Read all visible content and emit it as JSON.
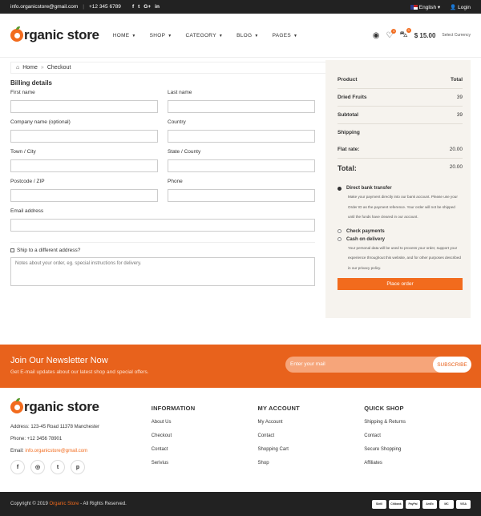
{
  "topbar": {
    "email": "info.organicstore@gmail.com",
    "phone": "+12 345 6789",
    "language": "English",
    "login": "Login",
    "social": [
      "f",
      "t",
      "G+",
      "in"
    ]
  },
  "header": {
    "logo_o": "O",
    "logo_text": "rganic store",
    "nav": [
      "HOME",
      "SHOP",
      "CATEGORY",
      "BLOG",
      "PAGES"
    ],
    "wishlist_count": "0",
    "cart_count": "0",
    "price": "$ 15.00",
    "currency": "Select Currency"
  },
  "breadcrumb": {
    "home": "Home",
    "current": "Checkout"
  },
  "billing": {
    "title": "Billing details",
    "first_name": "First name",
    "last_name": "Last name",
    "company": "Company name (optional)",
    "country": "Country",
    "town": "Town / City",
    "state": "State / County",
    "postcode": "Postcode / ZIP",
    "phone": "Phone",
    "email": "Email address",
    "ship_different": "Ship to a different address?",
    "notes_placeholder": "Notes about your order, eg. special instructions for delivery."
  },
  "order": {
    "product_h": "Product",
    "total_h": "Total",
    "item_name": "Dried Fruits",
    "item_total": "39",
    "subtotal_label": "Subtotal",
    "subtotal_value": "39",
    "shipping_label": "Shipping",
    "flat_rate_label": "Flat rate:",
    "flat_rate_value": "20.00",
    "total_label": "Total:",
    "total_value": "20.00",
    "pay_bank": "Direct bank transfer",
    "pay_bank_desc": "Make your payment directly into our bank account. Please use your Order ID as the payment reference. Your order will not be shipped until the funds have cleared in our account.",
    "pay_check": "Check payments",
    "pay_cod": "Cash on delivery",
    "privacy_desc": "Your personal data will be used to process your order, support your experience throughout this website, and for other purposes described in our privacy policy.",
    "place_order": "Place order"
  },
  "newsletter": {
    "title": "Join Our Newsletter Now",
    "subtitle": "Get E-mail updates about our latest shop and special offers.",
    "placeholder": "Enter your mail",
    "button": "SUBSCRIBE"
  },
  "footer": {
    "address": "Address: 123-45 Road 11378 Manchester",
    "phone": "Phone: +12 3456 78901",
    "email_label": "Email: ",
    "email": "info.organicstore@gmail.com",
    "info_title": "INFORMATION",
    "info_links": [
      "About Us",
      "Checkout",
      "Contact",
      "Serivius"
    ],
    "account_title": "MY ACCOUNT",
    "account_links": [
      "My Account",
      "Contact",
      "Shopping Cart",
      "Shop"
    ],
    "quick_title": "QUICK SHOP",
    "quick_links": [
      "Shipping & Returns",
      "Contact",
      "Secure Shopping",
      "Affiliates"
    ]
  },
  "bottom": {
    "copy_pre": "Copyright © 2019 ",
    "brand": "Organic Store",
    "copy_post": " - All Rights Reserved.",
    "cards": [
      "Skrill",
      "Citibank",
      "PayPal",
      "AmEx",
      "MC",
      "VISA"
    ]
  },
  "colors": {
    "accent": "#f26b1d",
    "dark": "#222222"
  }
}
